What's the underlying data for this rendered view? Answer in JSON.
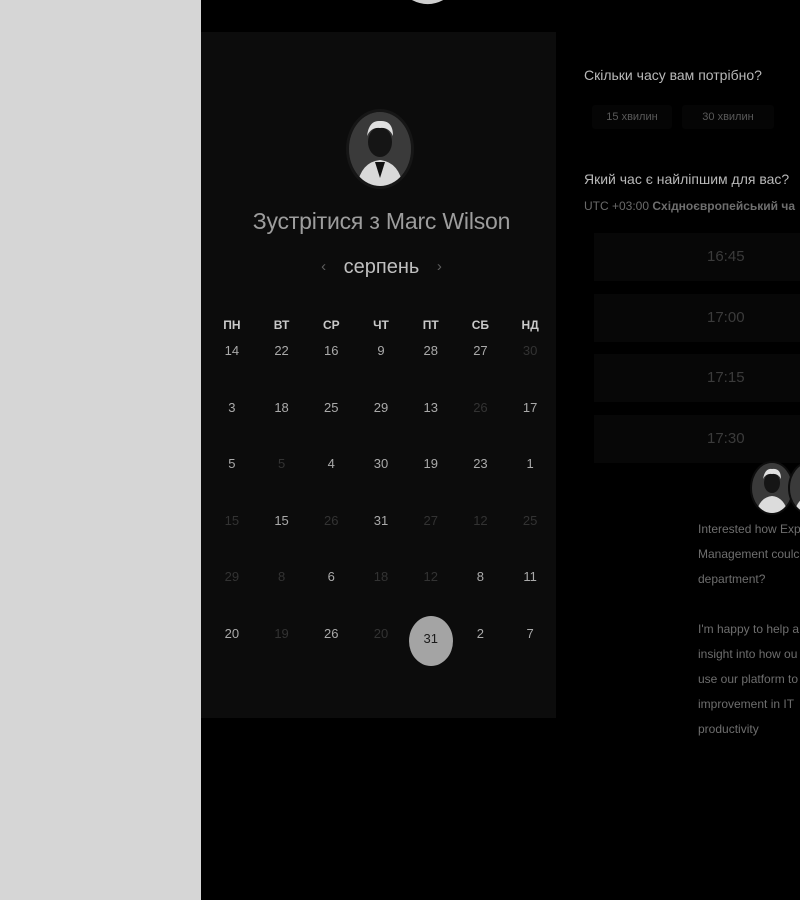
{
  "colors": {
    "background": "#000000",
    "left_strip": "#d6d6d6",
    "card": "#0c0c0c",
    "selected_day": "#a4a4a4"
  },
  "calendar": {
    "title_prefix": "Зустрітися з",
    "host_name": "Marc Wilson",
    "month": "серпень",
    "prev_icon": "chevron-left-icon",
    "next_icon": "chevron-right-icon",
    "weekdays": [
      "ПН",
      "ВТ",
      "СР",
      "ЧТ",
      "ПТ",
      "СБ",
      "НД"
    ],
    "weeks": [
      [
        {
          "d": "14"
        },
        {
          "d": "22"
        },
        {
          "d": "16"
        },
        {
          "d": "9"
        },
        {
          "d": "28"
        },
        {
          "d": "27"
        },
        {
          "d": "30",
          "dim": true
        }
      ],
      [
        {
          "d": "3"
        },
        {
          "d": "18"
        },
        {
          "d": "25"
        },
        {
          "d": "29"
        },
        {
          "d": "13"
        },
        {
          "d": "26",
          "dim": true
        },
        {
          "d": "17"
        }
      ],
      [
        {
          "d": "5"
        },
        {
          "d": "5",
          "dim": true
        },
        {
          "d": "4"
        },
        {
          "d": "30"
        },
        {
          "d": "19"
        },
        {
          "d": "23"
        },
        {
          "d": "1"
        }
      ],
      [
        {
          "d": "15",
          "dim": true
        },
        {
          "d": "15"
        },
        {
          "d": "26",
          "dim": true
        },
        {
          "d": "31"
        },
        {
          "d": "27",
          "dim": true
        },
        {
          "d": "12",
          "dim": true
        },
        {
          "d": "25",
          "dim": true
        }
      ],
      [
        {
          "d": "29",
          "dim": true
        },
        {
          "d": "8",
          "dim": true
        },
        {
          "d": "6"
        },
        {
          "d": "18",
          "dim": true
        },
        {
          "d": "12",
          "dim": true
        },
        {
          "d": "8"
        },
        {
          "d": "11"
        }
      ],
      [
        {
          "d": "20"
        },
        {
          "d": "19",
          "dim": true
        },
        {
          "d": "26"
        },
        {
          "d": "20",
          "dim": true
        },
        {
          "d": "31",
          "selected": true
        },
        {
          "d": "2"
        },
        {
          "d": "7"
        }
      ]
    ]
  },
  "duration": {
    "question": "Скільки часу вам потрібно?",
    "options": [
      "15 хвилин",
      "30 хвилин"
    ]
  },
  "time": {
    "question": "Який час є найліпшим для вас?",
    "tz_offset": "UTC +03:00",
    "tz_name": "Східноєвропейський ча",
    "slots": [
      "16:45",
      "17:00",
      "17:15",
      "17:30"
    ]
  },
  "message": {
    "lines": [
      "Interested how Exp",
      "Management coulc",
      "department?",
      "",
      "I'm happy to help a",
      "insight into how ou",
      "use our platform to",
      "improvement in IT",
      "productivity"
    ]
  }
}
